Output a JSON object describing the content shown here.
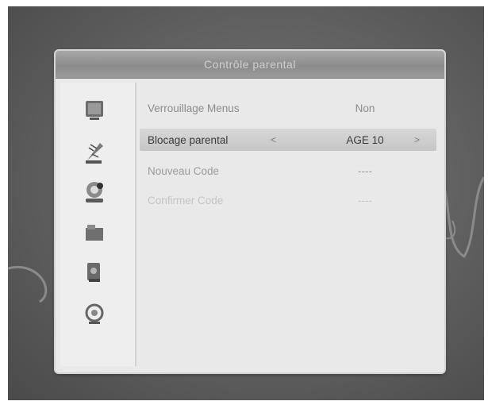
{
  "dialog": {
    "title": "Contrôle parental"
  },
  "sidebar": {
    "icons": [
      {
        "name": "tv-icon"
      },
      {
        "name": "satellite-dish-icon"
      },
      {
        "name": "system-settings-icon"
      },
      {
        "name": "folder-icon"
      },
      {
        "name": "game-icon"
      },
      {
        "name": "media-player-icon"
      }
    ]
  },
  "settings": [
    {
      "label": "Verrouillage Menus",
      "value": "Non"
    },
    {
      "label": "Blocage parental",
      "value": "AGE 10",
      "left_arrow": "<",
      "right_arrow": ">"
    },
    {
      "label": "Nouveau Code",
      "value": "----"
    },
    {
      "label": "Confirmer Code",
      "value": "----"
    }
  ],
  "colors": {
    "background": "#5f5f5f",
    "dialog": "#e9e9e9",
    "titlebar": "#9a9a9a",
    "highlight": "#cdcdcd"
  }
}
